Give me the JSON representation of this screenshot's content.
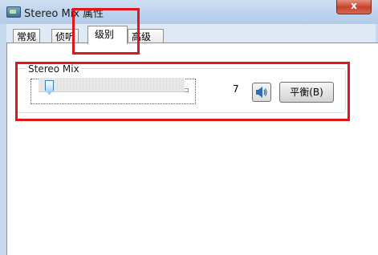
{
  "window": {
    "title": "Stereo Mix 属性",
    "close_label": "x"
  },
  "tabs": [
    {
      "label": "常规"
    },
    {
      "label": "侦听"
    },
    {
      "label": "级别"
    },
    {
      "label": "高级"
    }
  ],
  "active_tab": "级别",
  "level_group": {
    "title": "Stereo Mix",
    "slider_value": 7,
    "value_text": "7",
    "balance_label": "平衡(B)"
  },
  "icons": {
    "speaker": "speaker-icon",
    "app": "app-icon"
  },
  "colors": {
    "highlight": "#e0161c"
  }
}
